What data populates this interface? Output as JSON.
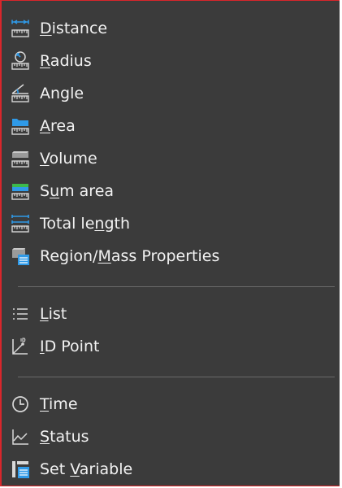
{
  "menu": {
    "groups": [
      {
        "items": [
          {
            "name": "distance",
            "icon": "distance-ruler-icon",
            "before": "",
            "mnemonic": "D",
            "after": "istance"
          },
          {
            "name": "radius",
            "icon": "radius-ruler-icon",
            "before": "",
            "mnemonic": "R",
            "after": "adius"
          },
          {
            "name": "angle",
            "icon": "angle-ruler-icon",
            "before": "",
            "mnemonic": "",
            "after": "Angle"
          },
          {
            "name": "area",
            "icon": "area-ruler-icon",
            "before": "",
            "mnemonic": "A",
            "after": "rea"
          },
          {
            "name": "volume",
            "icon": "volume-ruler-icon",
            "before": "",
            "mnemonic": "V",
            "after": "olume"
          },
          {
            "name": "sum-area",
            "icon": "sum-area-ruler-icon",
            "before": "S",
            "mnemonic": "u",
            "after": "m area"
          },
          {
            "name": "total-length",
            "icon": "total-length-icon",
            "before": "Total le",
            "mnemonic": "n",
            "after": "gth"
          },
          {
            "name": "region-mass-properties",
            "icon": "region-mass-properties-icon",
            "before": "Region/",
            "mnemonic": "M",
            "after": "ass Properties"
          }
        ]
      },
      {
        "items": [
          {
            "name": "list",
            "icon": "list-icon",
            "before": "",
            "mnemonic": "L",
            "after": "ist"
          },
          {
            "name": "id-point",
            "icon": "id-point-icon",
            "before": "",
            "mnemonic": "I",
            "after": "D Point"
          }
        ]
      },
      {
        "items": [
          {
            "name": "time",
            "icon": "clock-icon",
            "before": "",
            "mnemonic": "T",
            "after": "ime"
          },
          {
            "name": "status",
            "icon": "status-chart-icon",
            "before": "",
            "mnemonic": "S",
            "after": "tatus"
          },
          {
            "name": "set-variable",
            "icon": "set-variable-icon",
            "before": "Set ",
            "mnemonic": "V",
            "after": "ariable"
          }
        ]
      }
    ]
  },
  "colors": {
    "background": "#3b3b3b",
    "text": "#f2f2f2",
    "accent_blue": "#2f9ae8",
    "accent_green": "#3cba4c",
    "frame": "#d9262b"
  }
}
